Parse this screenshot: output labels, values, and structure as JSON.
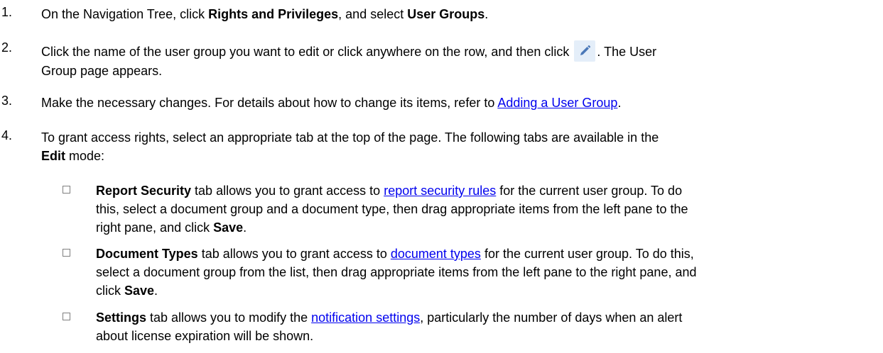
{
  "steps": [
    {
      "num": "1.",
      "t1": "On the Navigation Tree, click ",
      "b1": "Rights and Privileges",
      "t2": ", and select ",
      "b2": "User Groups",
      "t3": "."
    },
    {
      "num": "2.",
      "t1": "Click the name of the user group you want to edit or click anywhere on the row, and then click ",
      "t2": ". The User",
      "t3": "Group page appears."
    },
    {
      "num": "3.",
      "t1": "Make the necessary changes. For details about how to change its items, refer to ",
      "link": "Adding a User Group",
      "t2": "."
    },
    {
      "num": "4.",
      "t1": "To grant access rights, select an appropriate tab at the top of the page. The following tabs are available in the",
      "b1": "Edit",
      "t2": " mode:"
    }
  ],
  "subitems": [
    {
      "bold": "Report Security",
      "t1": " tab allows you to grant access to ",
      "link": "report security rules",
      "t2": " for the current user group. To do",
      "line2": "this, select a document group and a document type, then drag appropriate items from the left pane to the",
      "line3a": "right pane, and click ",
      "bold2": "Save",
      "line3b": "."
    },
    {
      "bold": "Document Types",
      "t1": " tab allows you to grant access to ",
      "link": "document types",
      "t2": " for the current user group. To do this,",
      "line2": "select a document group from the list, then drag appropriate items from the left pane to the right pane, and",
      "line3a": "click ",
      "bold2": "Save",
      "line3b": "."
    },
    {
      "bold": "Settings",
      "t1": " tab allows you to modify the ",
      "link": "notification settings",
      "t2": ", particularly the number of days when an alert",
      "line2": "about license expiration will be shown."
    }
  ],
  "icons": {
    "edit": "pencil-icon",
    "checkbox": "square-bullet-icon"
  },
  "colors": {
    "link": "#0000ee",
    "edit_button_bg": "#e4eef9",
    "pencil": "#4a78b8"
  }
}
